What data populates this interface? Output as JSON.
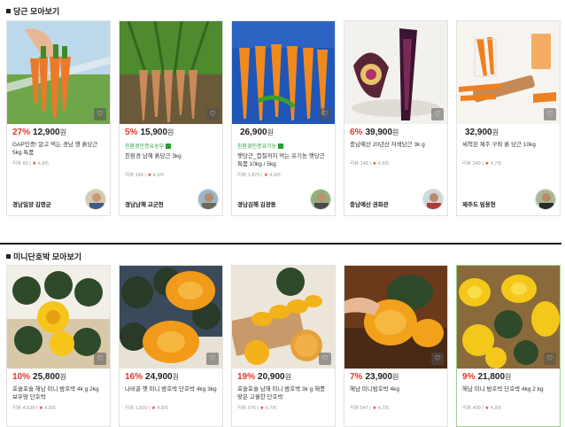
{
  "sections": [
    {
      "title": "당근 모아보기",
      "cards": [
        {
          "discount": "27%",
          "price": "12,900",
          "won": "원",
          "badge": "",
          "desc": "GAP인증! 알고 먹는 경남 행 흙당근 5kg 특품",
          "reviews": "리뷰 85",
          "rating": "4.8/5",
          "seller": "경남밀양 김명균",
          "wish_icon": "heart-icon"
        },
        {
          "discount": "5%",
          "price": "15,900",
          "won": "원",
          "badge": "친환경인증유농부",
          "desc": "친환경 남해 흙당근 3kg",
          "reviews": "리뷰 184",
          "rating": "4.6/5",
          "seller": "경남남해 교군천",
          "wish_icon": "heart-icon"
        },
        {
          "discount": "",
          "price": "26,900",
          "won": "원",
          "badge": "친환경인증유기농",
          "desc": "햇당근_껍질까지 먹는 유기농 햇당근 특품 10kg / 5kg",
          "reviews": "리뷰 1,875",
          "rating": "4.9/5",
          "seller": "경남김해 김광동",
          "wish_icon": "heart-icon"
        },
        {
          "discount": "6%",
          "price": "39,900",
          "won": "원",
          "badge": "",
          "desc": "충남예산 20년산 자색당근 3k g",
          "reviews": "리뷰 148",
          "rating": "4.8/5",
          "seller": "충남예산 권화관",
          "wish_icon": "heart-icon"
        },
        {
          "discount": "",
          "price": "32,900",
          "won": "원",
          "badge": "",
          "desc": "세척된 제주 구좌 흙 당근 10kg",
          "reviews": "리뷰 349",
          "rating": "4.7/5",
          "seller": "제주도 임용현",
          "wish_icon": "heart-icon"
        }
      ]
    },
    {
      "title": "미니단호박 모아보기",
      "cards": [
        {
          "discount": "10%",
          "price": "25,800",
          "won": "원",
          "badge": "",
          "desc": "포슬포슬 해남 미니 밤호박 4k g 2kg 보우땅 단호박",
          "reviews": "리뷰 4,638",
          "rating": "4.8/5",
          "seller": "",
          "wish_icon": "heart-icon"
        },
        {
          "discount": "16%",
          "price": "24,900",
          "won": "원",
          "badge": "",
          "desc": "나비골 햇 미니 밤호박 단호박 4kg 3kg",
          "reviews": "리뷰 1,830",
          "rating": "4.8/5",
          "seller": "",
          "wish_icon": "heart-icon"
        },
        {
          "discount": "19%",
          "price": "20,900",
          "won": "원",
          "badge": "",
          "desc": "포슬포슬 남해 미니 밤호박 3k g 해풍맞은 고퀄한 단호박",
          "reviews": "리뷰 576",
          "rating": "4.7/5",
          "seller": "",
          "wish_icon": "heart-icon"
        },
        {
          "discount": "7%",
          "price": "23,900",
          "won": "원",
          "badge": "",
          "desc": "해남 미니밤호박 4kg",
          "reviews": "리뷰 547",
          "rating": "4.7/5",
          "seller": "",
          "wish_icon": "heart-icon"
        },
        {
          "discount": "9%",
          "price": "21,800",
          "won": "원",
          "badge": "",
          "desc": "해남 미니 밤호박 단호박 4kg 2 kg",
          "reviews": "리뷰 409",
          "rating": "4.8/5",
          "seller": "",
          "wish_icon": "heart-icon"
        }
      ]
    }
  ],
  "colors": {
    "discount": "#e4362b",
    "badge": "#2a9d3a",
    "selected_border": "#9bd28a"
  }
}
